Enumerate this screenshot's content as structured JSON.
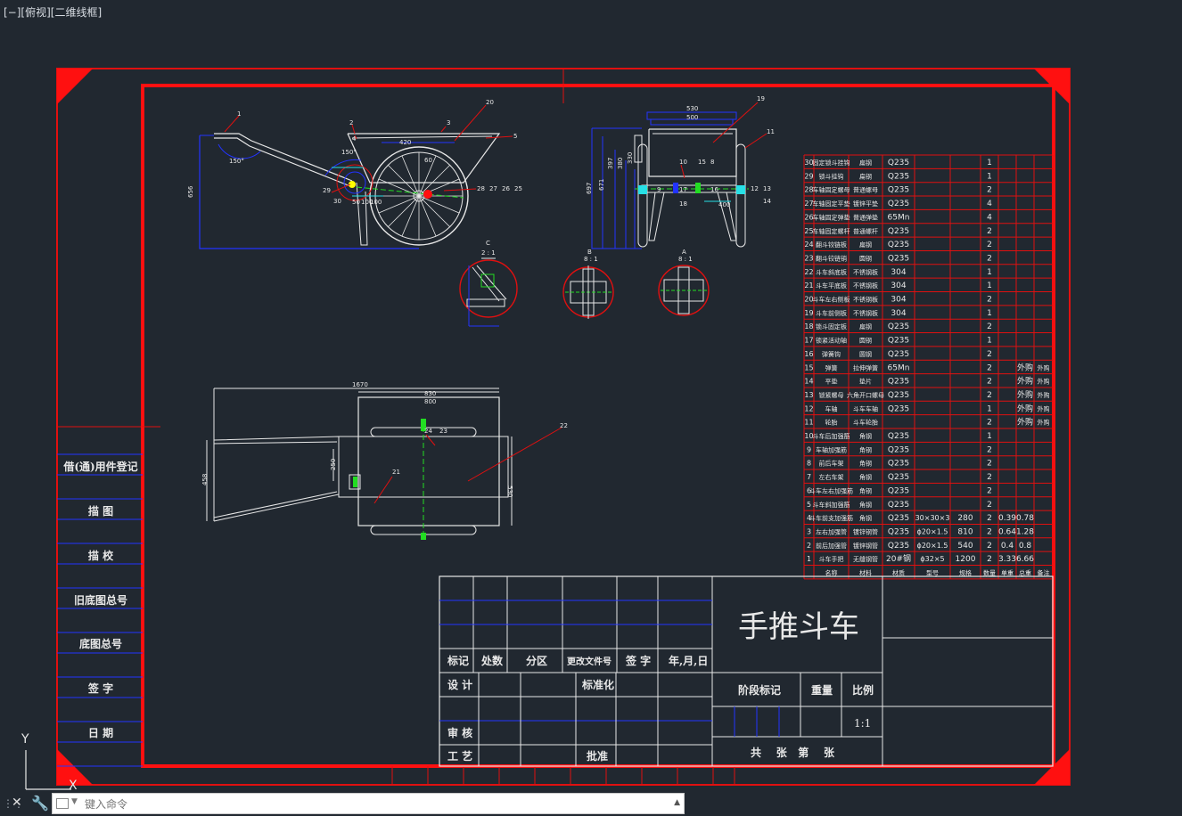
{
  "viewport": {
    "label": "[−][俯视][二维线框]"
  },
  "title_block": {
    "drawing_name": "手推斗车",
    "headers": [
      "标记",
      "处数",
      "分区",
      "更改文件号",
      "签 字",
      "年,月,日"
    ],
    "design": "设 计",
    "standard": "标准化",
    "review": "审 核",
    "process": "工 艺",
    "approve": "批准",
    "stage_mark": "阶段标记",
    "weight": "重量",
    "scale_label": "比例",
    "scale_value": "1:1",
    "sheets": "共    张   第    张"
  },
  "side_column": [
    "借(通)用件登记",
    "描  图",
    "描  校",
    "旧底图总号",
    "底图总号",
    "签  字",
    "日  期"
  ],
  "bom": {
    "rows": [
      [
        "30",
        "固定锁斗挂钩",
        "扁钢",
        "Q235",
        "",
        "",
        "1",
        "",
        ""
      ],
      [
        "29",
        "锁斗挂钩",
        "扁钢",
        "Q235",
        "",
        "",
        "1",
        "",
        ""
      ],
      [
        "28",
        "车轴固定螺母",
        "普通螺母",
        "Q235",
        "",
        "",
        "2",
        "",
        ""
      ],
      [
        "27",
        "车轴固定平垫",
        "镀锌平垫",
        "Q235",
        "",
        "",
        "4",
        "",
        ""
      ],
      [
        "26",
        "车轴固定弹垫",
        "普通弹垫",
        "65Mn",
        "",
        "",
        "4",
        "",
        ""
      ],
      [
        "25",
        "车轴固定螺杆",
        "普通螺杆",
        "Q235",
        "",
        "",
        "2",
        "",
        ""
      ],
      [
        "24",
        "翻斗铰链板",
        "扁钢",
        "Q235",
        "",
        "",
        "2",
        "",
        ""
      ],
      [
        "23",
        "翻斗铰链销",
        "圆钢",
        "Q235",
        "",
        "",
        "2",
        "",
        ""
      ],
      [
        "22",
        "斗车斜底板",
        "不锈钢板",
        "304",
        "",
        "",
        "1",
        "",
        ""
      ],
      [
        "21",
        "斗车平底板",
        "不锈钢板",
        "304",
        "",
        "",
        "1",
        "",
        ""
      ],
      [
        "20",
        "斗车左右侧板",
        "不锈钢板",
        "304",
        "",
        "",
        "2",
        "",
        ""
      ],
      [
        "19",
        "斗车前侧板",
        "不锈钢板",
        "304",
        "",
        "",
        "1",
        "",
        ""
      ],
      [
        "18",
        "锁斗固定板",
        "扁钢",
        "Q235",
        "",
        "",
        "2",
        "",
        ""
      ],
      [
        "17",
        "锁紧活动轴",
        "圆钢",
        "Q235",
        "",
        "",
        "1",
        "",
        ""
      ],
      [
        "16",
        "弹簧钩",
        "圆钢",
        "Q235",
        "",
        "",
        "2",
        "",
        ""
      ],
      [
        "15",
        "弹簧",
        "拉伸弹簧",
        "65Mn",
        "",
        "",
        "2",
        "",
        "外购"
      ],
      [
        "14",
        "平垫",
        "垫片",
        "Q235",
        "",
        "",
        "2",
        "",
        "外购"
      ],
      [
        "13",
        "锁紧螺母",
        "六角开口螺母",
        "Q235",
        "",
        "",
        "2",
        "",
        "外购"
      ],
      [
        "12",
        "车轴",
        "斗车车轴",
        "Q235",
        "",
        "",
        "1",
        "",
        "外购"
      ],
      [
        "11",
        "轮胎",
        "斗车轮胎",
        "",
        "",
        "",
        "2",
        "",
        "外购"
      ],
      [
        "10",
        "斗车后加强筋",
        "角钢",
        "Q235",
        "",
        "",
        "1",
        "",
        ""
      ],
      [
        "9",
        "车轴加强筋",
        "角钢",
        "Q235",
        "",
        "",
        "2",
        "",
        ""
      ],
      [
        "8",
        "前后车架",
        "角钢",
        "Q235",
        "",
        "",
        "2",
        "",
        ""
      ],
      [
        "7",
        "左右车架",
        "角钢",
        "Q235",
        "",
        "",
        "2",
        "",
        ""
      ],
      [
        "6",
        "斗车左右加强筋",
        "角钢",
        "Q235",
        "",
        "",
        "2",
        "",
        ""
      ],
      [
        "5",
        "斗车斜加强筋",
        "角钢",
        "Q235",
        "",
        "",
        "2",
        "",
        ""
      ],
      [
        "4",
        "斗车前支加强筋",
        "角钢",
        "Q235",
        "30×30×3",
        "280",
        "2",
        "0.39",
        "0.78"
      ],
      [
        "3",
        "左右加强管",
        "镀锌钢管",
        "Q235",
        "ϕ20×1.5",
        "810",
        "2",
        "0.64",
        "1.28"
      ],
      [
        "2",
        "前后加强管",
        "镀锌钢管",
        "Q235",
        "ϕ20×1.5",
        "540",
        "2",
        "0.4",
        "0.8"
      ],
      [
        "1",
        "斗车手把",
        "无缝钢管",
        "20#钢",
        "ϕ32×5",
        "1200",
        "2",
        "3.33",
        "6.66"
      ]
    ],
    "header": [
      "",
      "名称",
      "材料",
      "材质",
      "型号",
      "规格",
      "数量",
      "单重",
      "总重",
      "备注"
    ]
  },
  "side_view": {
    "angle1": "150°",
    "angle2": "150°",
    "dims": [
      "420",
      "60",
      "656",
      "50",
      "100",
      "100"
    ],
    "callouts": [
      "1",
      "2",
      "3",
      "4",
      "5",
      "20",
      "29",
      "26",
      "27",
      "28",
      "25",
      "30"
    ]
  },
  "front_view": {
    "dims": [
      "530",
      "500",
      "697",
      "671",
      "397",
      "380",
      "330",
      "400"
    ],
    "callouts": [
      "19",
      "11",
      "10",
      "15",
      "8",
      "9",
      "17",
      "18",
      "16",
      "12",
      "13",
      "14"
    ]
  },
  "details": {
    "c_label": "C",
    "c_scale": "2 : 1",
    "b_label": "B",
    "b_scale": "8 : 1",
    "a_label": "A",
    "a_scale": "8 : 1"
  },
  "top_view": {
    "dims": [
      "1670",
      "830",
      "800",
      "458",
      "250",
      "530"
    ],
    "callouts": [
      "24",
      "23",
      "22",
      "21"
    ]
  },
  "ucs": {
    "y": "Y",
    "x": "X"
  },
  "command": {
    "placeholder": "键入命令"
  },
  "colors": {
    "background": "#212830",
    "frame_red": "#ff1010",
    "border_red": "#e01010",
    "line_blue": "#2233ff",
    "line_white": "#e8e8e8",
    "dim_cyan": "#27e0e6",
    "green": "#22dd22"
  }
}
